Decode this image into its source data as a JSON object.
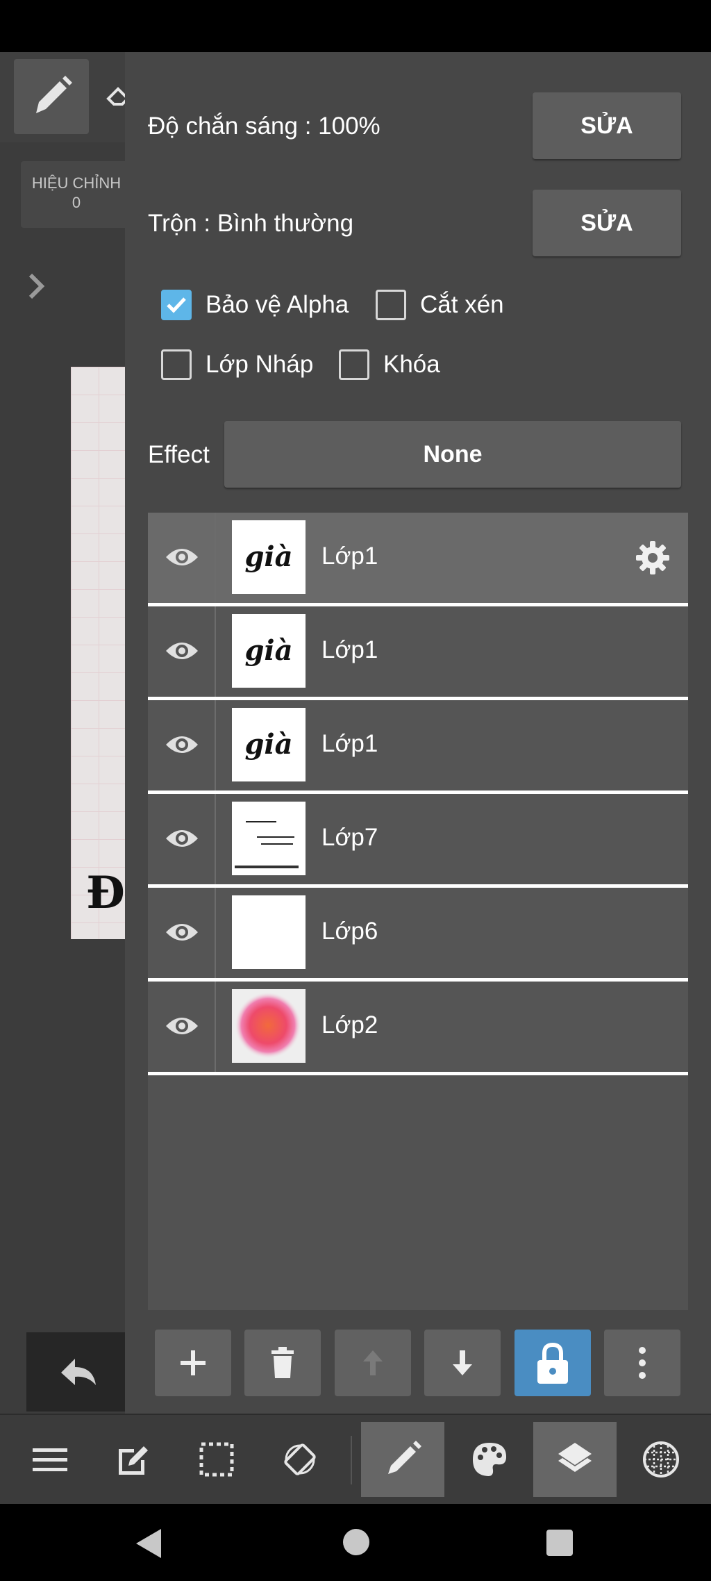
{
  "panel": {
    "opacity_label": "Độ chắn sáng : 100%",
    "opacity_edit": "SỬA",
    "blend_label": "Trộn : Bình thường",
    "blend_edit": "SỬA",
    "checkboxes": [
      {
        "label": "Bảo vệ Alpha",
        "checked": true
      },
      {
        "label": "Cắt xén",
        "checked": false
      },
      {
        "label": "Lớp Nháp",
        "checked": false
      },
      {
        "label": "Khóa",
        "checked": false
      }
    ],
    "effect_label": "Effect",
    "effect_value": "None"
  },
  "layers": [
    {
      "name": "Lớp1",
      "selected": true,
      "thumb_text": "già"
    },
    {
      "name": "Lớp1",
      "selected": false,
      "thumb_text": "già"
    },
    {
      "name": "Lớp1",
      "selected": false,
      "thumb_text": "già"
    },
    {
      "name": "Lớp7",
      "selected": false,
      "thumb_text": ""
    },
    {
      "name": "Lớp6",
      "selected": false,
      "thumb_text": ""
    },
    {
      "name": "Lớp2",
      "selected": false,
      "thumb_text": ""
    }
  ],
  "layer_actions": [
    "add-icon",
    "trash-icon",
    "arrow-up-icon",
    "arrow-down-icon",
    "lock-icon",
    "more-vertical-icon"
  ],
  "left": {
    "adjust_label": "HIỆU CHỈNH",
    "adjust_value": "0"
  },
  "toolbar": [
    "menu-icon",
    "edit-icon",
    "selection-icon",
    "rotate-icon",
    "pen-icon",
    "palette-icon",
    "layers-icon",
    "grid-icon"
  ],
  "colors": {
    "accent": "#5eb6e8",
    "lock_active": "#4a8dc2",
    "panel": "#474747"
  }
}
